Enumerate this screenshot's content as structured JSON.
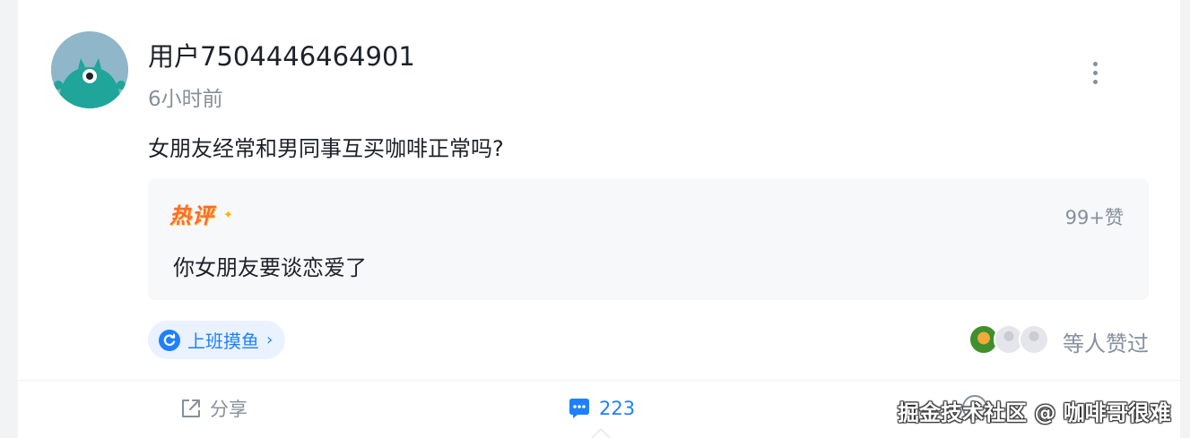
{
  "post": {
    "author_name": "用户7504446464901",
    "time": "6小时前",
    "content": "女朋友经常和男同事互买咖啡正常吗?"
  },
  "hot_comment": {
    "badge": "热评",
    "likes": "99+赞",
    "text": "你女朋友要谈恋爱了"
  },
  "topic": {
    "label": "上班摸鱼",
    "arrow": "›"
  },
  "likers": {
    "text": "等人赞过"
  },
  "actions": {
    "share_label": "分享",
    "comment_count": "223"
  },
  "watermark": "掘金技术社区 @ 咖啡哥很难",
  "colors": {
    "accent": "#1e80ff",
    "text_primary": "#1d2129",
    "text_secondary": "#86909c",
    "hot_badge": "#ff6a2f",
    "hot_box_bg": "#f7f8fa",
    "avatar_bg": "#8fb7c9",
    "avatar_monster": "#1fa59a"
  },
  "icons": {
    "more": "more-vertical-icon",
    "topic": "refresh-circle-icon",
    "share": "share-icon",
    "comment": "comment-bubble-icon"
  }
}
